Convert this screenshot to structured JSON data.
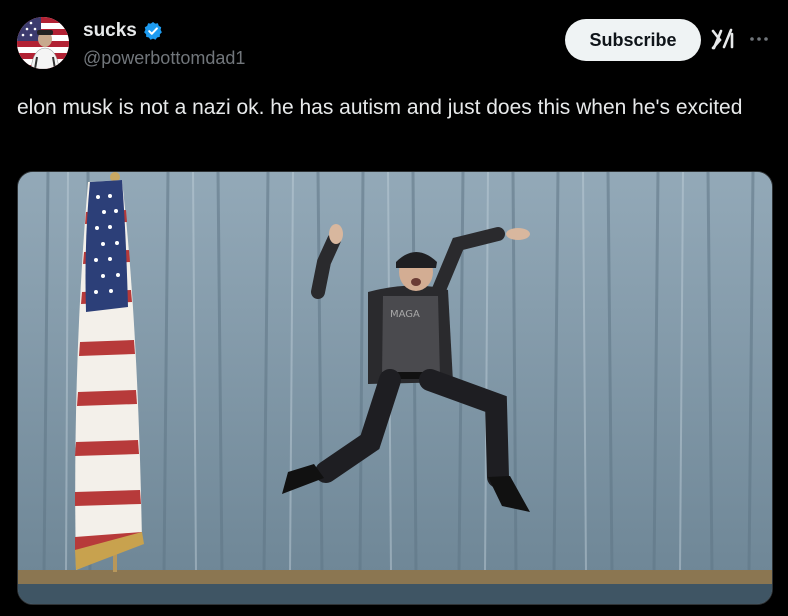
{
  "post": {
    "author": {
      "display_name": "sucks",
      "handle": "@powerbottomdad1",
      "verified": true,
      "avatar_icon": "avatar-flag-photo"
    },
    "actions": {
      "subscribe_label": "Subscribe",
      "grok_icon": "grok-icon",
      "more_icon": "more-icon"
    },
    "text": "elon musk is not a nazi ok. he has autism and just does this when he's excited",
    "media": {
      "description_icon": "photo"
    }
  },
  "colors": {
    "background": "#000000",
    "text_primary": "#e7e9ea",
    "text_secondary": "#71767b",
    "verified_blue": "#1d9bf0",
    "subscribe_bg": "#eff3f4",
    "subscribe_text": "#0f1419"
  }
}
